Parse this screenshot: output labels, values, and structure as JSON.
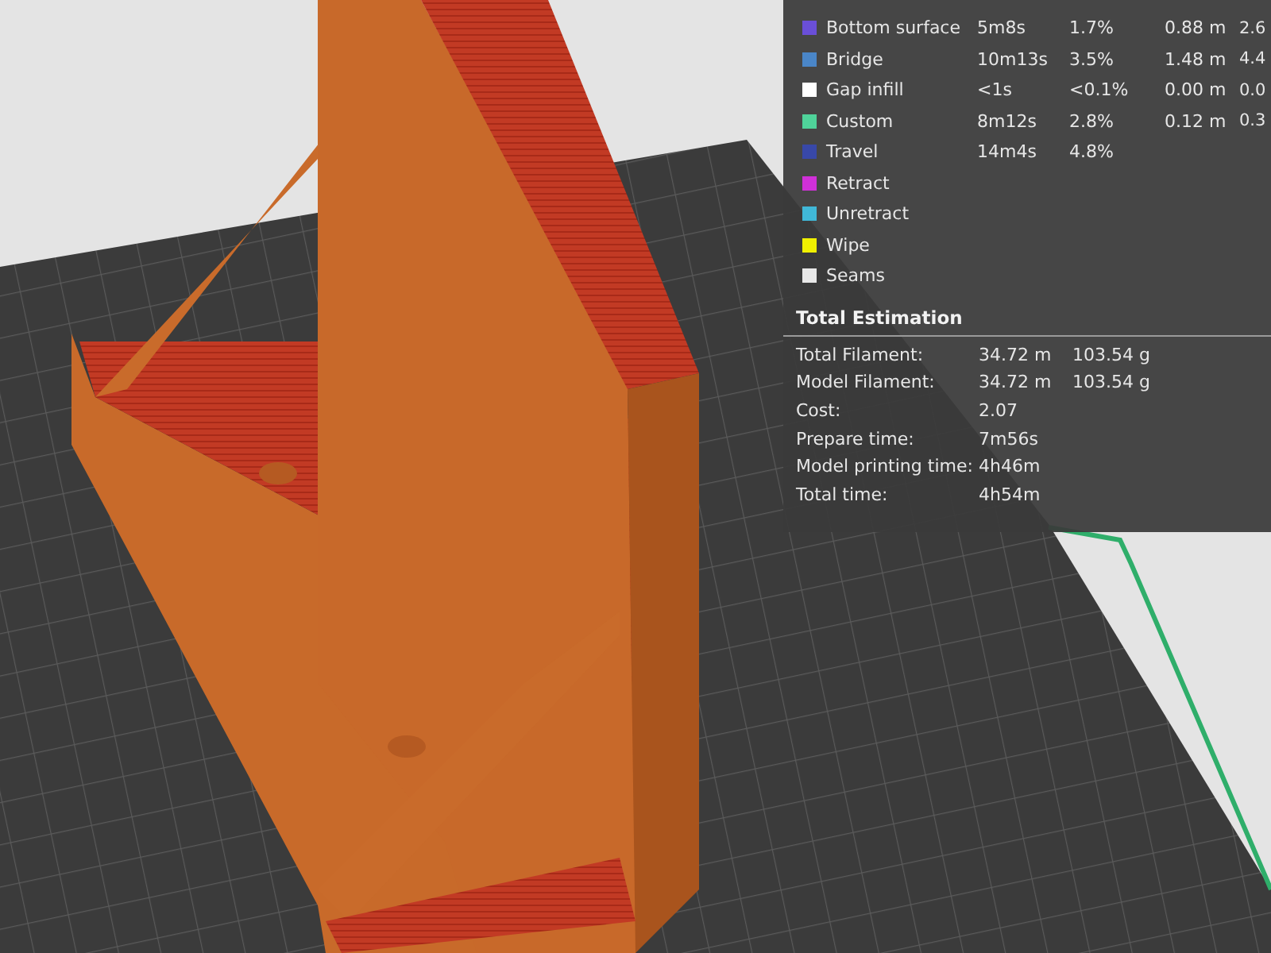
{
  "legend": [
    {
      "name": "Bottom surface",
      "color": "#6a4fd8",
      "time": "5m8s",
      "percent": "1.7%",
      "length": "0.88 m",
      "weight": "2.6"
    },
    {
      "name": "Bridge",
      "color": "#4a86c8",
      "time": "10m13s",
      "percent": "3.5%",
      "length": "1.48 m",
      "weight": "4.4"
    },
    {
      "name": "Gap infill",
      "color": "#ffffff",
      "time": "<1s",
      "percent": "<0.1%",
      "length": "0.00 m",
      "weight": "0.0"
    },
    {
      "name": "Custom",
      "color": "#4fd39a",
      "time": "8m12s",
      "percent": "2.8%",
      "length": "0.12 m",
      "weight": "0.3"
    },
    {
      "name": "Travel",
      "color": "#3848a8",
      "time": "14m4s",
      "percent": "4.8%"
    },
    {
      "name": "Retract",
      "color": "#d030d8"
    },
    {
      "name": "Unretract",
      "color": "#40b8d8"
    },
    {
      "name": "Wipe",
      "color": "#f0f000"
    },
    {
      "name": "Seams",
      "color": "#e8e8e8"
    }
  ],
  "total_estimation": {
    "title": "Total Estimation",
    "rows": [
      {
        "label": "Total Filament:",
        "values": [
          "34.72 m",
          "103.54 g"
        ]
      },
      {
        "label": "Model Filament:",
        "values": [
          "34.72 m",
          "103.54 g"
        ]
      },
      {
        "label": "Cost:",
        "values": [
          "2.07"
        ]
      },
      {
        "label": "Prepare time:",
        "values": [
          "7m56s"
        ]
      },
      {
        "label": "Model printing time:",
        "values": [
          "4h46m"
        ]
      },
      {
        "label": "Total time:",
        "values": [
          "4h54m"
        ]
      }
    ]
  }
}
